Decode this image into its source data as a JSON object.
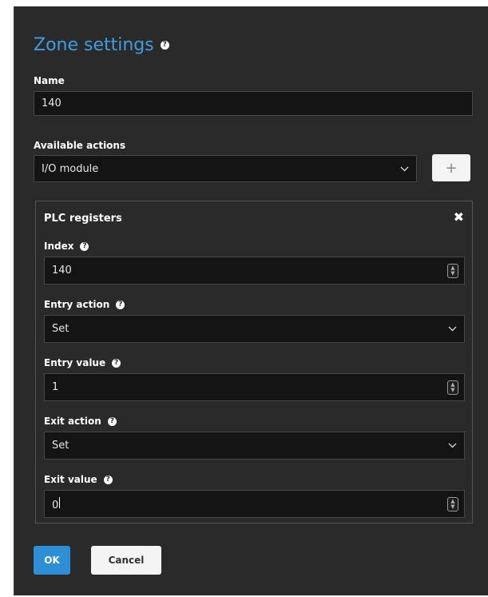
{
  "dialog": {
    "title": "Zone settings",
    "help_icon": "question-circle-icon"
  },
  "name": {
    "label": "Name",
    "value": "140"
  },
  "available_actions": {
    "label": "Available actions",
    "selected": "I/O module",
    "add_label": "+"
  },
  "plc": {
    "title": "PLC registers",
    "close_label": "✖",
    "index": {
      "label": "Index",
      "value": "140"
    },
    "entry_action": {
      "label": "Entry action",
      "selected": "Set"
    },
    "entry_value": {
      "label": "Entry value",
      "value": "1"
    },
    "exit_action": {
      "label": "Exit action",
      "selected": "Set"
    },
    "exit_value": {
      "label": "Exit value",
      "value": "0"
    }
  },
  "footer": {
    "ok_label": "OK",
    "cancel_label": "Cancel"
  },
  "colors": {
    "accent": "#3d9ee0",
    "ok_button": "#2d8fd6",
    "dialog_bg": "#2a2a2a",
    "field_bg": "#141414"
  }
}
